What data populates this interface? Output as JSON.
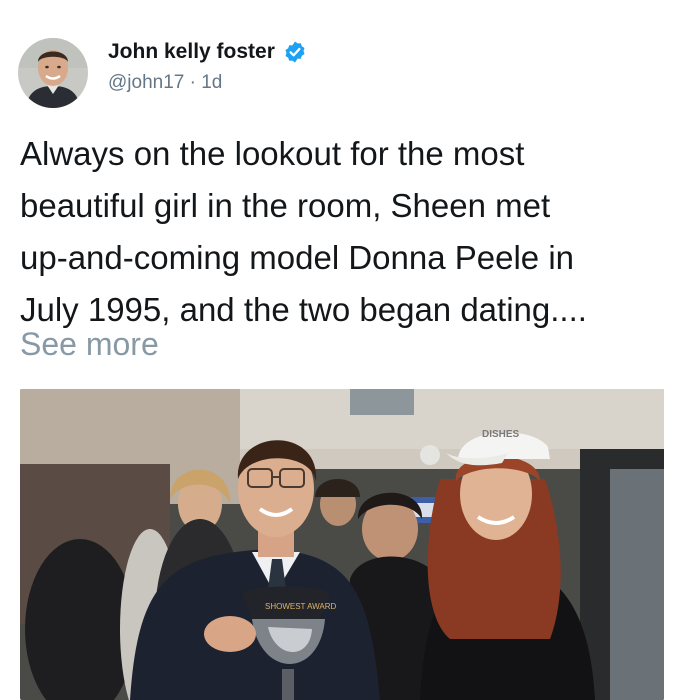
{
  "author": {
    "display_name": "John kelly foster",
    "handle": "@john17",
    "separator": "·",
    "time": "1d",
    "verified_icon": "verified-badge-icon",
    "verified_color": "#1da1f2"
  },
  "tweet": {
    "lines": [
      "Always on the lookout for the most",
      "beautiful girl in the room, Sheen met",
      "up-and-coming model Donna Peele in",
      "July 1995, and the two began dating...."
    ],
    "see_more": "See more"
  },
  "photo": {
    "cap_text": "DISHES",
    "trophy_text": "SHOWEST AWARD"
  }
}
